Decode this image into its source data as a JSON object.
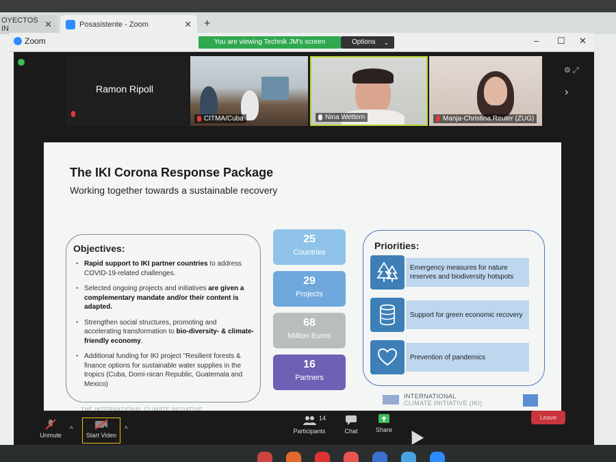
{
  "browser": {
    "tabs": [
      {
        "label": "OYECTOS IN",
        "close": "✕"
      },
      {
        "label": "Posasistente - Zoom",
        "close": "✕"
      }
    ],
    "new_tab": "+"
  },
  "zoom_window": {
    "title": "Zoom",
    "minimize": "–",
    "maximize": "☐",
    "close": "✕"
  },
  "share_banner": {
    "text": "You are viewing Technik JM's screen",
    "options_label": "Options",
    "options_chevron": "⌄"
  },
  "participants_strip": {
    "speaker_name": "Ramon Ripoll",
    "tiles": [
      {
        "label": "CITMA/Cuba",
        "muted": true
      },
      {
        "label": "Nina Wettern",
        "muted": false
      },
      {
        "label": "Manja-Christina Reuter (ZUG)",
        "muted": true
      }
    ],
    "next_arrow": "›"
  },
  "slide": {
    "title": "The IKI Corona Response Package",
    "subtitle": "Working together towards a sustainable recovery",
    "objectives": {
      "heading": "Objectives:",
      "items": [
        {
          "bold": "Rapid support to IKI partner countries",
          "text": " to address COVID-19-related challenges."
        },
        {
          "pre": "Selected ongoing projects and initiatives ",
          "bold": "are given a complementary mandate and/or their content is adapted."
        },
        {
          "pre": "Strengthen social structures, promoting and accelerating transformation to ",
          "bold": "bio-diversity- & climate-friendly economy",
          "post": "."
        },
        {
          "pre": "Additional funding for IKI project \"Resilient forests & finance options for sustainable water supplies in the tropics (Cuba, Domi-nican Republic, Guatemala and Mexico)"
        }
      ]
    },
    "stats": [
      {
        "number": "25",
        "label": "Countries",
        "color": "#8fc3ea"
      },
      {
        "number": "29",
        "label": "Projects",
        "color": "#6fa8dc"
      },
      {
        "number": "68",
        "label": "Million Euros",
        "color": "#b9bdbc"
      },
      {
        "number": "16",
        "label": "Partners",
        "color": "#6f5fb5"
      }
    ],
    "priorities": {
      "heading": "Priorities:",
      "items": [
        {
          "icon": "trees-icon",
          "text": "Emergency measures for nature reserves and biodiversity hotspots"
        },
        {
          "icon": "coins-icon",
          "text": "Support for green economic recovery"
        },
        {
          "icon": "heart-icon",
          "text": "Prevention of pandemics"
        }
      ]
    },
    "logo_text": "INTERNATIONAL",
    "logo_text2": "CLIMATE INITIATIVE (IKI)",
    "footer_text": "THE INTERNATIONAL CLIMATE INITIATIVE"
  },
  "toolbar": {
    "unmute": "Unmute",
    "start_video": "Start Video",
    "participants": "Participants",
    "participants_count": "14",
    "chat": "Chat",
    "share": "Share",
    "leave": "Leave",
    "caret": "^"
  }
}
